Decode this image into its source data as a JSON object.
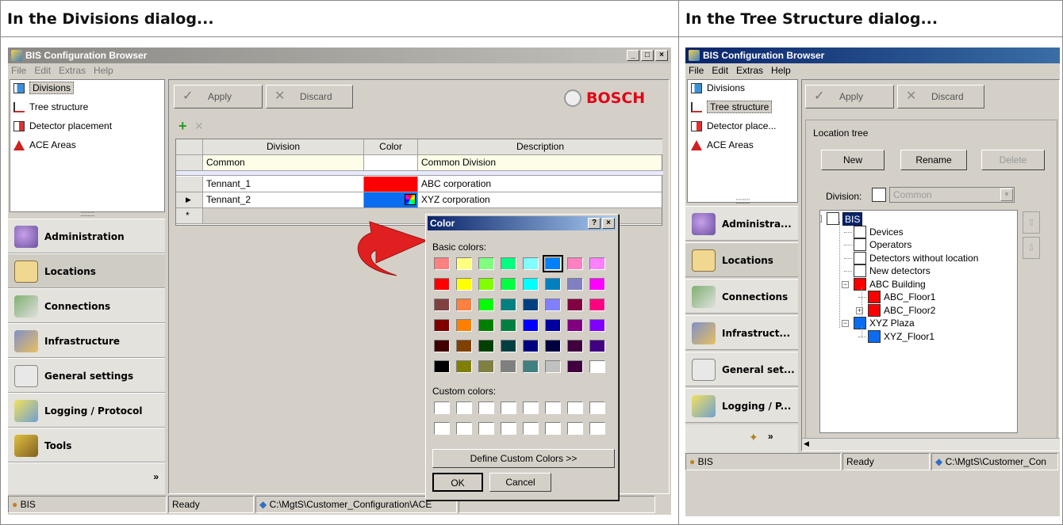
{
  "headers": {
    "left": "In the Divisions dialog...",
    "right": "In the Tree Structure dialog..."
  },
  "app": {
    "title": "BIS Configuration Browser",
    "menu": [
      "File",
      "Edit",
      "Extras",
      "Help"
    ],
    "window_buttons": [
      "_",
      "□",
      "×"
    ]
  },
  "nav_items": [
    {
      "label": "Divisions",
      "icon": "divisions-icon"
    },
    {
      "label": "Tree structure",
      "icon": "tree-icon"
    },
    {
      "label": "Detector placement",
      "icon": "detector-placement-icon"
    },
    {
      "label": "ACE Areas",
      "icon": "ace-areas-icon"
    }
  ],
  "nav_items_right": [
    "Divisions",
    "Tree structure",
    "Detector place...",
    "ACE Areas"
  ],
  "sections_left": [
    "Administration",
    "Locations",
    "Connections",
    "Infrastructure",
    "General settings",
    "Logging / Protocol",
    "Tools"
  ],
  "sections_right": [
    "Administra...",
    "Locations",
    "Connections",
    "Infrastruct...",
    "General set...",
    "Logging / P..."
  ],
  "toolbar": {
    "apply": "Apply",
    "discard": "Discard",
    "brand": "BOSCH"
  },
  "grid": {
    "columns": [
      "Division",
      "Color",
      "Description"
    ],
    "rows": [
      {
        "division": "Common",
        "color": "#ffffff",
        "description": "Common Division"
      },
      {
        "division": "Tennant_1",
        "color": "#ff0000",
        "description": "ABC corporation"
      },
      {
        "division": "Tennant_2",
        "color": "#0a6cf0",
        "description": "XYZ corporation"
      }
    ],
    "new_row_marker": "*",
    "current_row_marker": "▶"
  },
  "color_dialog": {
    "title": "Color",
    "basic_label": "Basic colors:",
    "custom_label": "Custom colors:",
    "define_button": "Define Custom Colors >>",
    "ok": "OK",
    "cancel": "Cancel",
    "title_buttons": [
      "?",
      "×"
    ],
    "basic_colors": [
      "#ff8080",
      "#ffff80",
      "#80ff80",
      "#00ff80",
      "#80ffff",
      "#0080ff",
      "#ff80c0",
      "#ff80ff",
      "#ff0000",
      "#ffff00",
      "#80ff00",
      "#00ff40",
      "#00ffff",
      "#0080c0",
      "#8080c0",
      "#ff00ff",
      "#804040",
      "#ff8040",
      "#00ff00",
      "#008080",
      "#004080",
      "#8080ff",
      "#800040",
      "#ff0080",
      "#800000",
      "#ff8000",
      "#008000",
      "#008040",
      "#0000ff",
      "#0000a0",
      "#800080",
      "#8000ff",
      "#400000",
      "#804000",
      "#004000",
      "#004040",
      "#000080",
      "#000040",
      "#400040",
      "#400080",
      "#000000",
      "#808000",
      "#808040",
      "#808080",
      "#408080",
      "#c0c0c0",
      "#400040",
      "#ffffff"
    ],
    "selected_index": 5
  },
  "status_left": {
    "user": "BIS",
    "state": "Ready",
    "path": "C:\\MgtS\\Customer_Configuration\\ACE"
  },
  "status_right": {
    "user": "BIS",
    "state": "Ready",
    "path": "C:\\MgtS\\Customer_Con"
  },
  "location_tree": {
    "group_label": "Location tree",
    "new": "New",
    "rename": "Rename",
    "delete": "Delete",
    "division_label": "Division:",
    "division_value": "Common",
    "nodes": [
      {
        "label": "BIS",
        "color": "#ffffff",
        "level": 0,
        "expander": "-"
      },
      {
        "label": "Devices",
        "color": "#ffffff",
        "level": 1,
        "expander": ""
      },
      {
        "label": "Operators",
        "color": "#ffffff",
        "level": 1,
        "expander": ""
      },
      {
        "label": "Detectors without location",
        "color": "#ffffff",
        "level": 1,
        "expander": ""
      },
      {
        "label": "New detectors",
        "color": "#ffffff",
        "level": 1,
        "expander": ""
      },
      {
        "label": "ABC Building",
        "color": "#ff0000",
        "level": 1,
        "expander": "-"
      },
      {
        "label": "ABC_Floor1",
        "color": "#ff0000",
        "level": 2,
        "expander": ""
      },
      {
        "label": "ABC_Floor2",
        "color": "#ff0000",
        "level": 2,
        "expander": "+"
      },
      {
        "label": "XYZ Plaza",
        "color": "#0a6cf0",
        "level": 1,
        "expander": "-"
      },
      {
        "label": "XYZ_Floor1",
        "color": "#0a6cf0",
        "level": 2,
        "expander": ""
      }
    ]
  },
  "colors": {
    "titlebar_left": "#9c9a94",
    "titlebar_right": "#0a246a",
    "accent_red": "#e02020"
  }
}
